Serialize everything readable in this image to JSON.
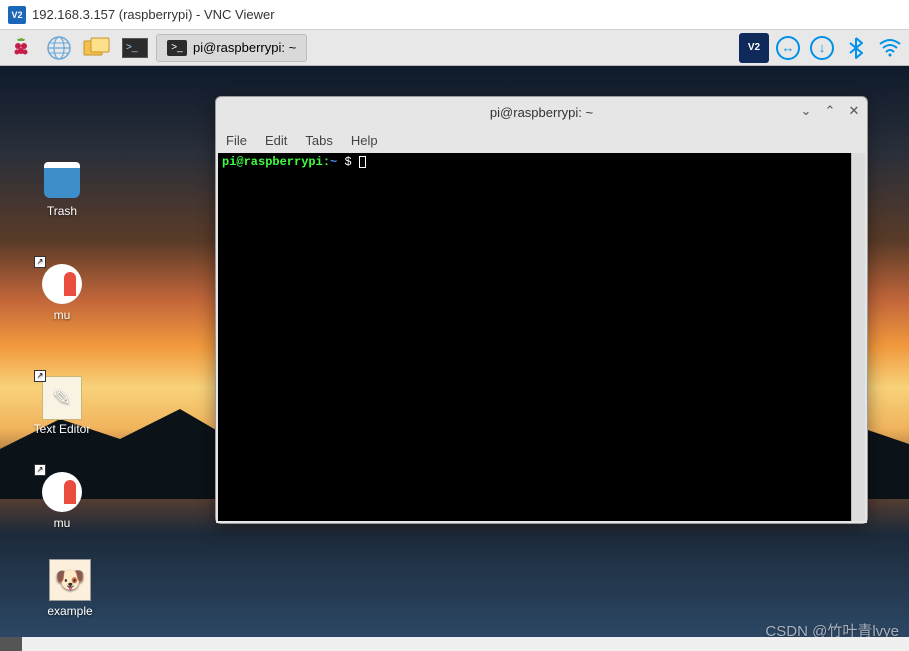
{
  "host": {
    "title": "192.168.3.157 (raspberrypi) - VNC Viewer"
  },
  "taskbar": {
    "task_label": "pi@raspberrypi: ~",
    "icons": {
      "start": "raspberry-icon",
      "web": "globe-icon",
      "files": "files-icon",
      "terminal": "terminal-icon"
    },
    "tray": {
      "vnc": "VNC",
      "anydesk": "anydesk",
      "download": "download",
      "bluetooth": "bluetooth",
      "wifi": "wifi"
    }
  },
  "desktop_icons": [
    {
      "key": "trash",
      "label": "Trash"
    },
    {
      "key": "mu1",
      "label": "mu"
    },
    {
      "key": "texteditor",
      "label": "Text Editor"
    },
    {
      "key": "mu2",
      "label": "mu"
    },
    {
      "key": "example",
      "label": "example"
    }
  ],
  "terminal": {
    "title": "pi@raspberrypi: ~",
    "menu": {
      "file": "File",
      "edit": "Edit",
      "tabs": "Tabs",
      "help": "Help"
    },
    "prompt": {
      "userhost": "pi@raspberrypi:",
      "path": "~",
      "symbol": "$"
    }
  },
  "watermark": "CSDN @竹叶青lvye"
}
